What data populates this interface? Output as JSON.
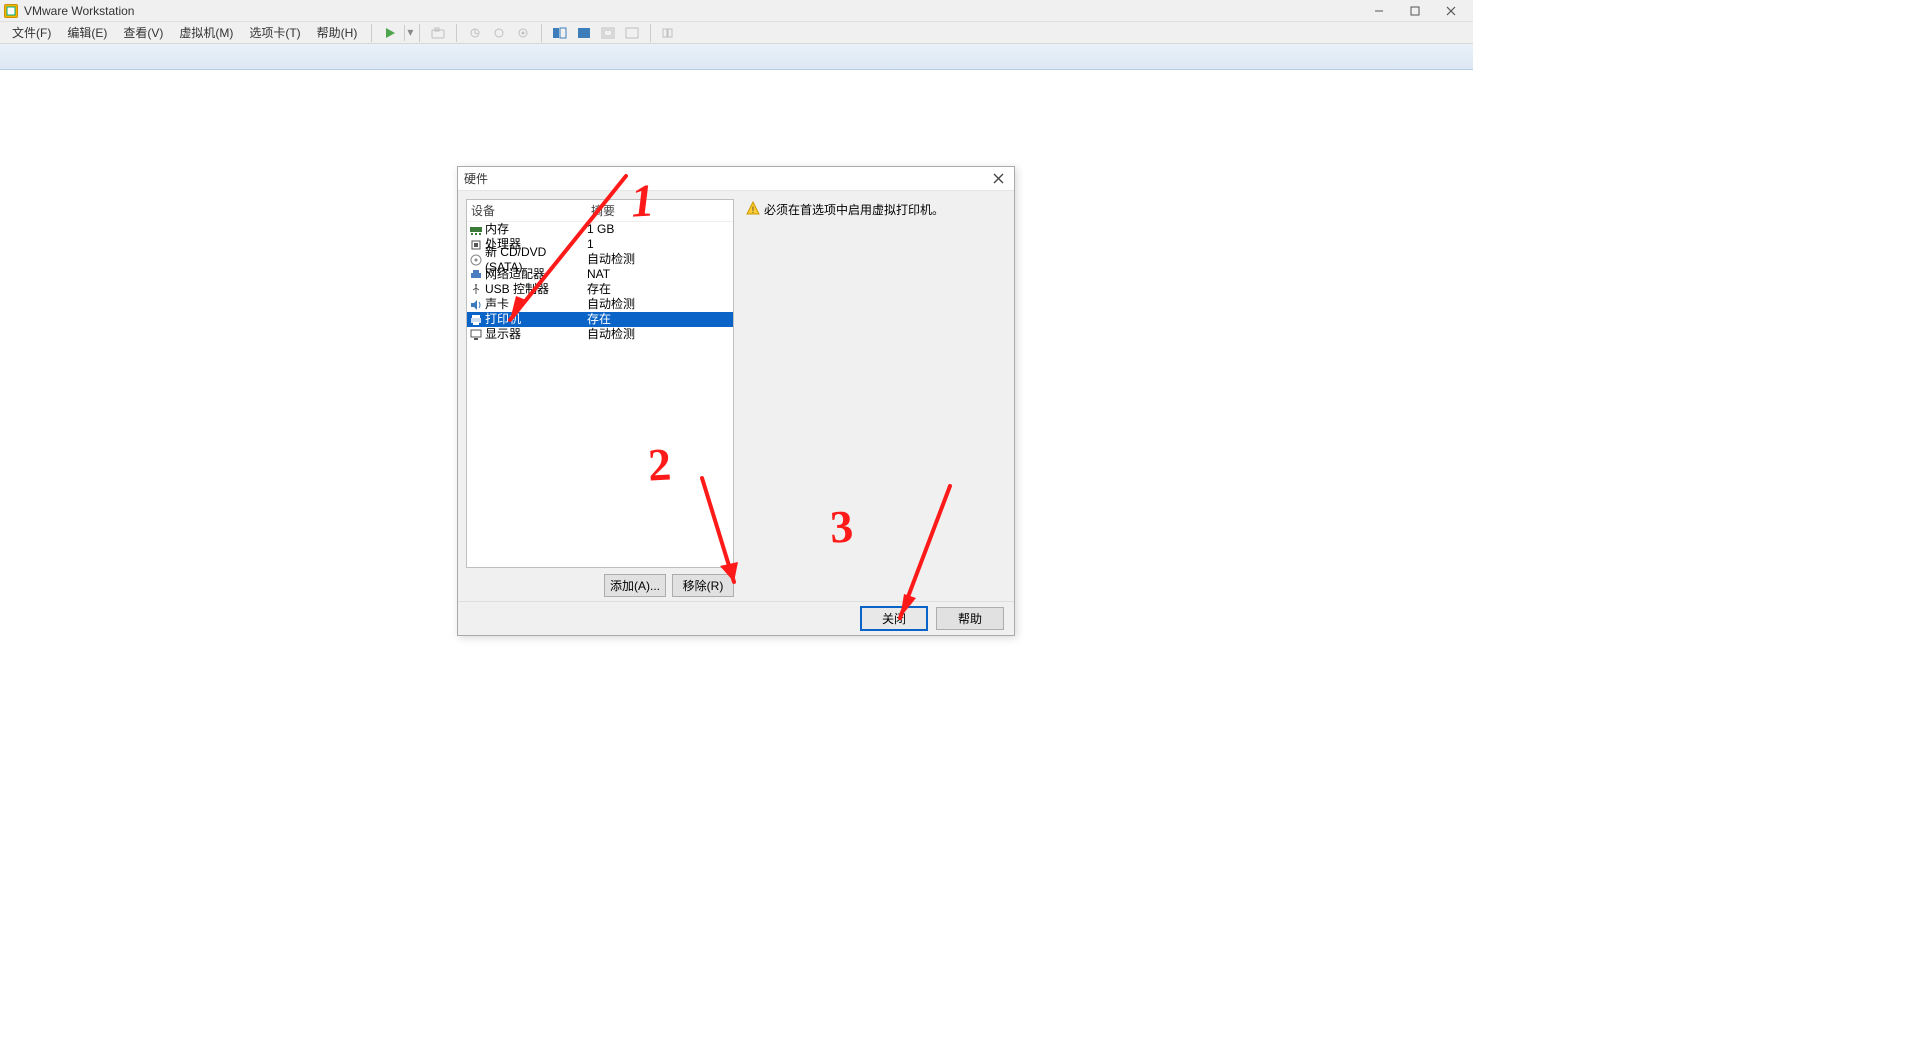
{
  "titlebar": {
    "app_name": "VMware Workstation"
  },
  "menubar": {
    "items": [
      "文件(F)",
      "编辑(E)",
      "查看(V)",
      "虚拟机(M)",
      "选项卡(T)",
      "帮助(H)"
    ]
  },
  "dialog": {
    "title": "硬件",
    "headers": {
      "device": "设备",
      "summary": "摘要"
    },
    "rows": [
      {
        "icon": "memory-icon",
        "name": "内存",
        "summary": "1 GB"
      },
      {
        "icon": "cpu-icon",
        "name": "处理器",
        "summary": "1"
      },
      {
        "icon": "disc-icon",
        "name": "新 CD/DVD (SATA)",
        "summary": "自动检测"
      },
      {
        "icon": "network-icon",
        "name": "网络适配器",
        "summary": "NAT"
      },
      {
        "icon": "usb-icon",
        "name": "USB 控制器",
        "summary": "存在"
      },
      {
        "icon": "sound-icon",
        "name": "声卡",
        "summary": "自动检测"
      },
      {
        "icon": "printer-icon",
        "name": "打印机",
        "summary": "存在",
        "selected": true
      },
      {
        "icon": "display-icon",
        "name": "显示器",
        "summary": "自动检测"
      }
    ],
    "add_label": "添加(A)...",
    "remove_label": "移除(R)",
    "warn_text": "必须在首选项中启用虚拟打印机。",
    "close_label": "关闭",
    "help_label": "帮助"
  },
  "annotations": {
    "n1": "1",
    "n2": "2",
    "n3": "3"
  }
}
